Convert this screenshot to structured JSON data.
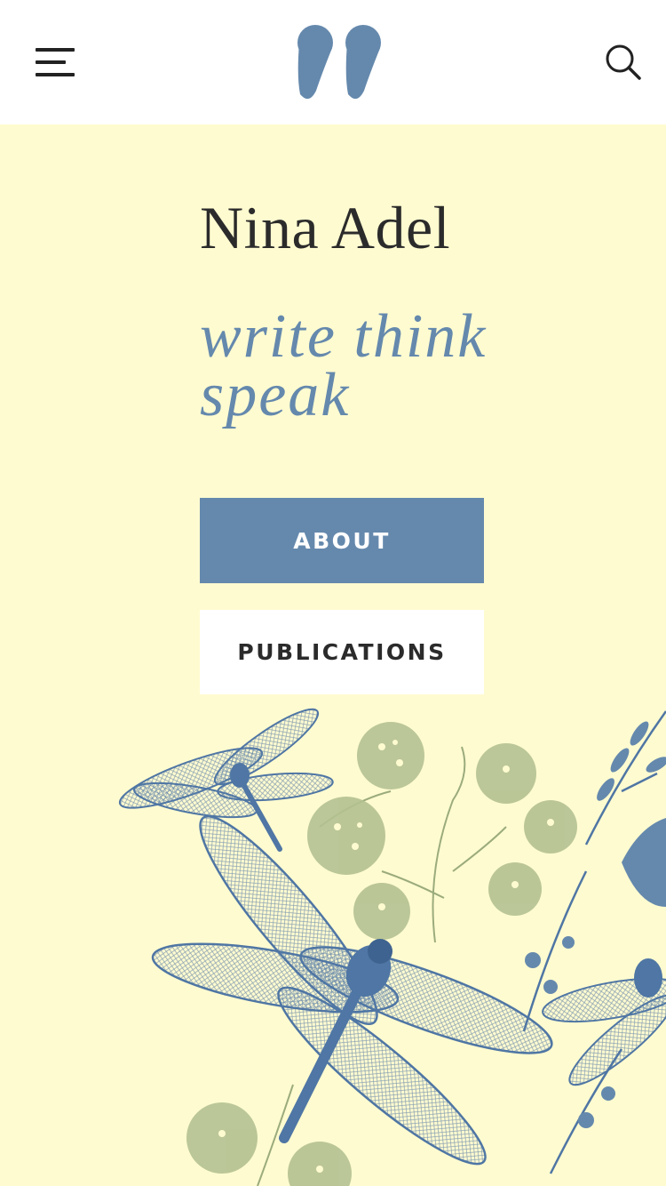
{
  "header": {
    "menu_icon": "hamburger-menu-icon",
    "logo_icon": "quotation-mark-logo",
    "search_icon": "magnifier-icon",
    "logo_color": "#6589ad"
  },
  "hero": {
    "title": "Nina Adel",
    "tagline": "write think speak",
    "background_color": "#fffbd0",
    "accent_color": "#6589ad"
  },
  "buttons": {
    "about_label": "ABOUT",
    "publications_label": "PUBLICATIONS"
  },
  "illustration": {
    "description_icon": "dragonfly-and-wildflowers-illustration",
    "dragonfly_color": "#5d83ad",
    "flower_color": "#9bab7c"
  }
}
